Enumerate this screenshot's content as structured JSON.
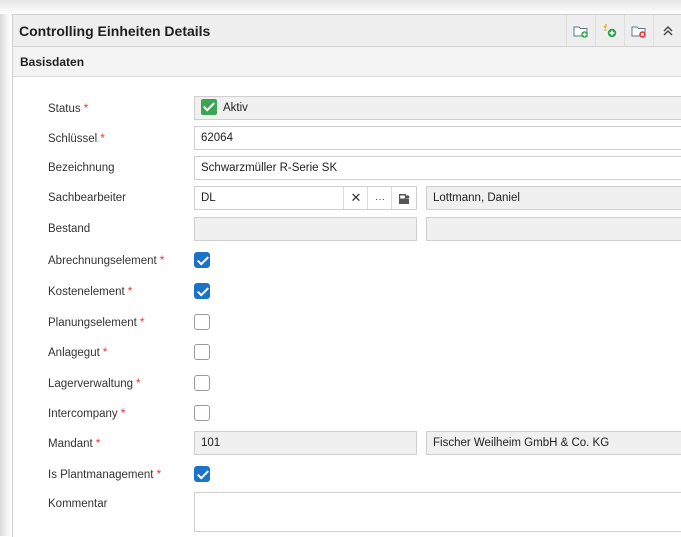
{
  "header": {
    "title": "Controlling Einheiten Details"
  },
  "section": {
    "title": "Basisdaten"
  },
  "fields": {
    "status": {
      "label": "Status",
      "value": "Aktiv"
    },
    "schluessel": {
      "label": "Schlüssel",
      "value": "62064"
    },
    "bezeichnung": {
      "label": "Bezeichnung",
      "value": "Schwarzmüller R-Serie SK"
    },
    "sachbearbeiter": {
      "label": "Sachbearbeiter",
      "code": "DL",
      "name": "Lottmann, Daniel",
      "clear_glyph": "✕",
      "more_glyph": "···"
    },
    "bestand": {
      "label": "Bestand",
      "value": "",
      "value2": ""
    },
    "abrechnungselement": {
      "label": "Abrechnungselement",
      "checked": true
    },
    "kostenelement": {
      "label": "Kostenelement",
      "checked": true
    },
    "planungselement": {
      "label": "Planungselement",
      "checked": false
    },
    "anlagegut": {
      "label": "Anlagegut",
      "checked": false
    },
    "lagerverwaltung": {
      "label": "Lagerverwaltung",
      "checked": false
    },
    "intercompany": {
      "label": "Intercompany",
      "checked": false
    },
    "mandant": {
      "label": "Mandant",
      "code": "101",
      "name": "Fischer Weilheim GmbH & Co. KG"
    },
    "plantmanagement": {
      "label": "Is Plantmanagement",
      "checked": true
    },
    "kommentar": {
      "label": "Kommentar",
      "value": ""
    }
  },
  "required_marker": "*",
  "colors": {
    "accent": "#1a73c9",
    "required": "#e23c3c",
    "status_ok": "#3aa655"
  },
  "icons": [
    "new-folder-icon",
    "add-icon",
    "delete-icon",
    "collapse-icon"
  ]
}
